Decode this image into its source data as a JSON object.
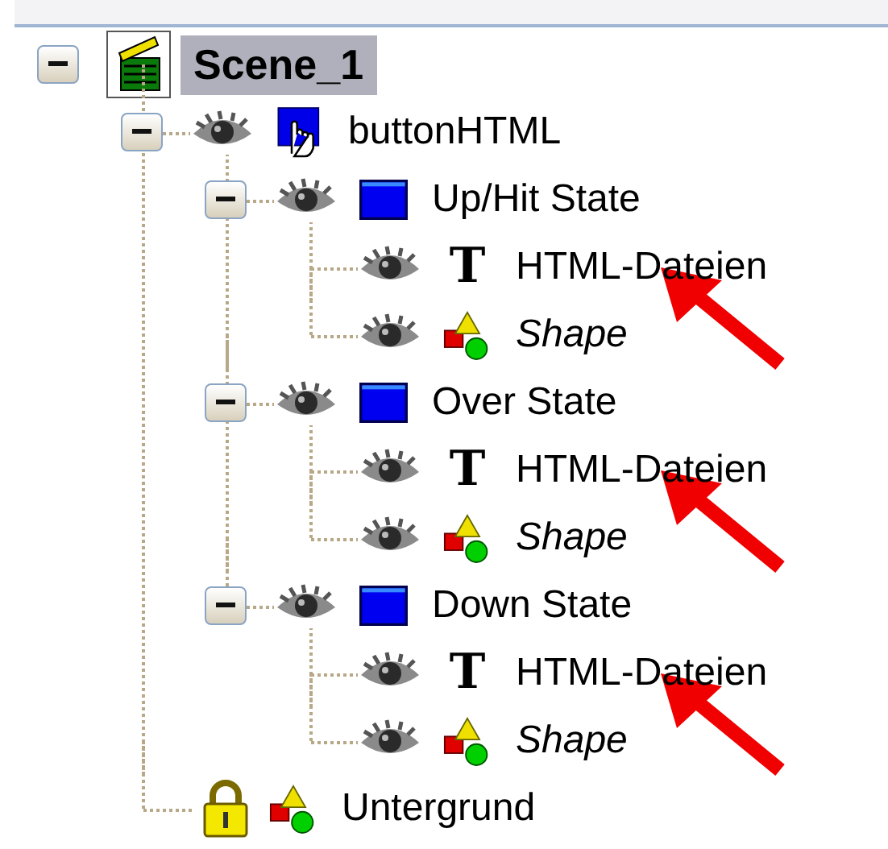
{
  "tree": [
    {
      "label": "Scene_1",
      "kind": "scene",
      "selected": true,
      "expanded": true,
      "children": [
        {
          "label": "buttonHTML",
          "kind": "button",
          "locked": false,
          "selected": false,
          "expanded": true,
          "children": [
            {
              "label": "Up/Hit State",
              "kind": "state",
              "locked": false,
              "selected": false,
              "expanded": true,
              "children": [
                {
                  "label": "HTML-Dateien",
                  "kind": "text",
                  "glyph": "T",
                  "locked": false,
                  "selected": false,
                  "annotated": true
                },
                {
                  "label": "Shape",
                  "kind": "shape",
                  "locked": false,
                  "selected": false
                }
              ]
            },
            {
              "label": "Over State",
              "kind": "state",
              "locked": false,
              "selected": false,
              "expanded": true,
              "children": [
                {
                  "label": "HTML-Dateien",
                  "kind": "text",
                  "glyph": "T",
                  "locked": false,
                  "selected": false,
                  "annotated": true
                },
                {
                  "label": "Shape",
                  "kind": "shape",
                  "locked": false,
                  "selected": false
                }
              ]
            },
            {
              "label": "Down State",
              "kind": "state",
              "locked": false,
              "selected": false,
              "expanded": true,
              "children": [
                {
                  "label": "HTML-Dateien",
                  "kind": "text",
                  "glyph": "T",
                  "locked": false,
                  "selected": false,
                  "annotated": true
                },
                {
                  "label": "Shape",
                  "kind": "shape",
                  "locked": false,
                  "selected": false
                }
              ]
            }
          ]
        },
        {
          "label": "Untergrund",
          "kind": "layer",
          "locked": true,
          "selected": false
        }
      ]
    }
  ]
}
